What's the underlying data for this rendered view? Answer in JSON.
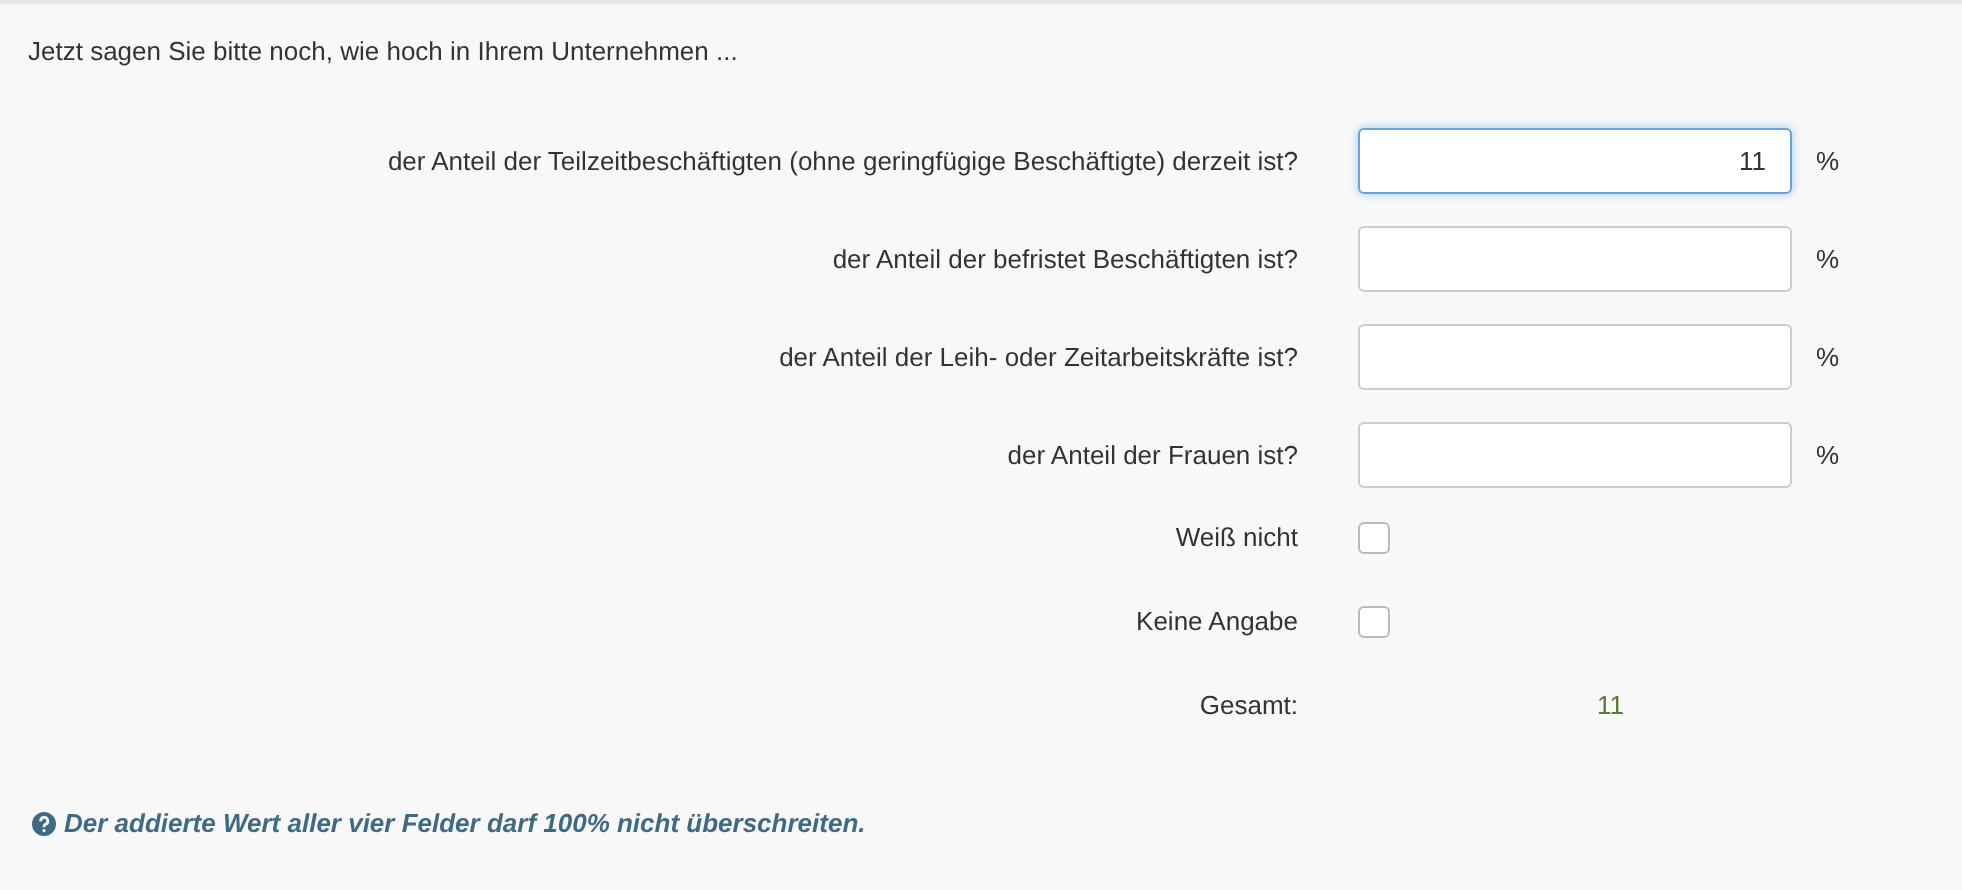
{
  "intro": "Jetzt sagen Sie bitte noch, wie hoch in Ihrem Unternehmen ...",
  "fields": [
    {
      "label": "der Anteil der Teilzeitbeschäftigten (ohne geringfügige Beschäftigte) derzeit ist?",
      "value": "11",
      "unit": "%",
      "focused": true
    },
    {
      "label": "der Anteil der befristet Beschäftigten ist?",
      "unit": "%",
      "focused": false
    },
    {
      "label": "der Anteil der Leih- oder Zeitarbeitskräfte ist?",
      "unit": "%",
      "focused": false
    },
    {
      "label": "der Anteil der Frauen ist?",
      "unit": "%",
      "focused": false
    }
  ],
  "options": [
    {
      "label": "Weiß nicht",
      "checked": false
    },
    {
      "label": "Keine Angabe",
      "checked": false
    }
  ],
  "total": {
    "label": "Gesamt:",
    "value": "11"
  },
  "hint": "Der addierte Wert aller vier Felder darf 100% nicht überschreiten."
}
